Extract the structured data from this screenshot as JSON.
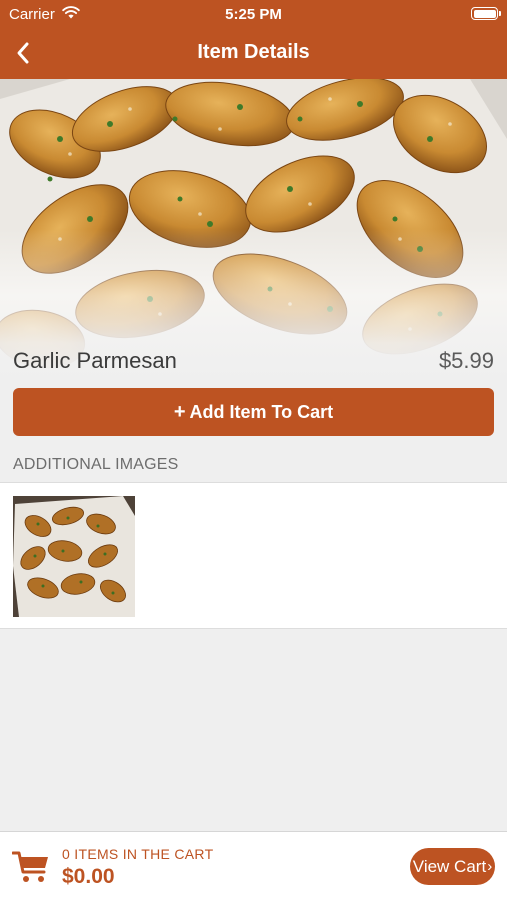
{
  "status_bar": {
    "carrier": "Carrier",
    "time": "5:25 PM"
  },
  "nav": {
    "title": "Item Details",
    "back_icon": "chevron-left-icon"
  },
  "item": {
    "name": "Garlic Parmesan",
    "price": "$5.99",
    "image": "garlic-parmesan-wings-photo"
  },
  "actions": {
    "add_to_cart_icon": "+",
    "add_to_cart_label": "Add Item To Cart"
  },
  "additional_images": {
    "header": "ADDITIONAL IMAGES",
    "images": [
      "garlic-parmesan-wings-thumbnail"
    ]
  },
  "cart": {
    "icon": "cart-icon",
    "count_label": "0 ITEMS IN THE CART",
    "total": "$0.00",
    "view_cart_label": "View Cart",
    "view_cart_chevron": "›"
  },
  "colors": {
    "accent": "#bd5322",
    "background": "#efefef"
  }
}
